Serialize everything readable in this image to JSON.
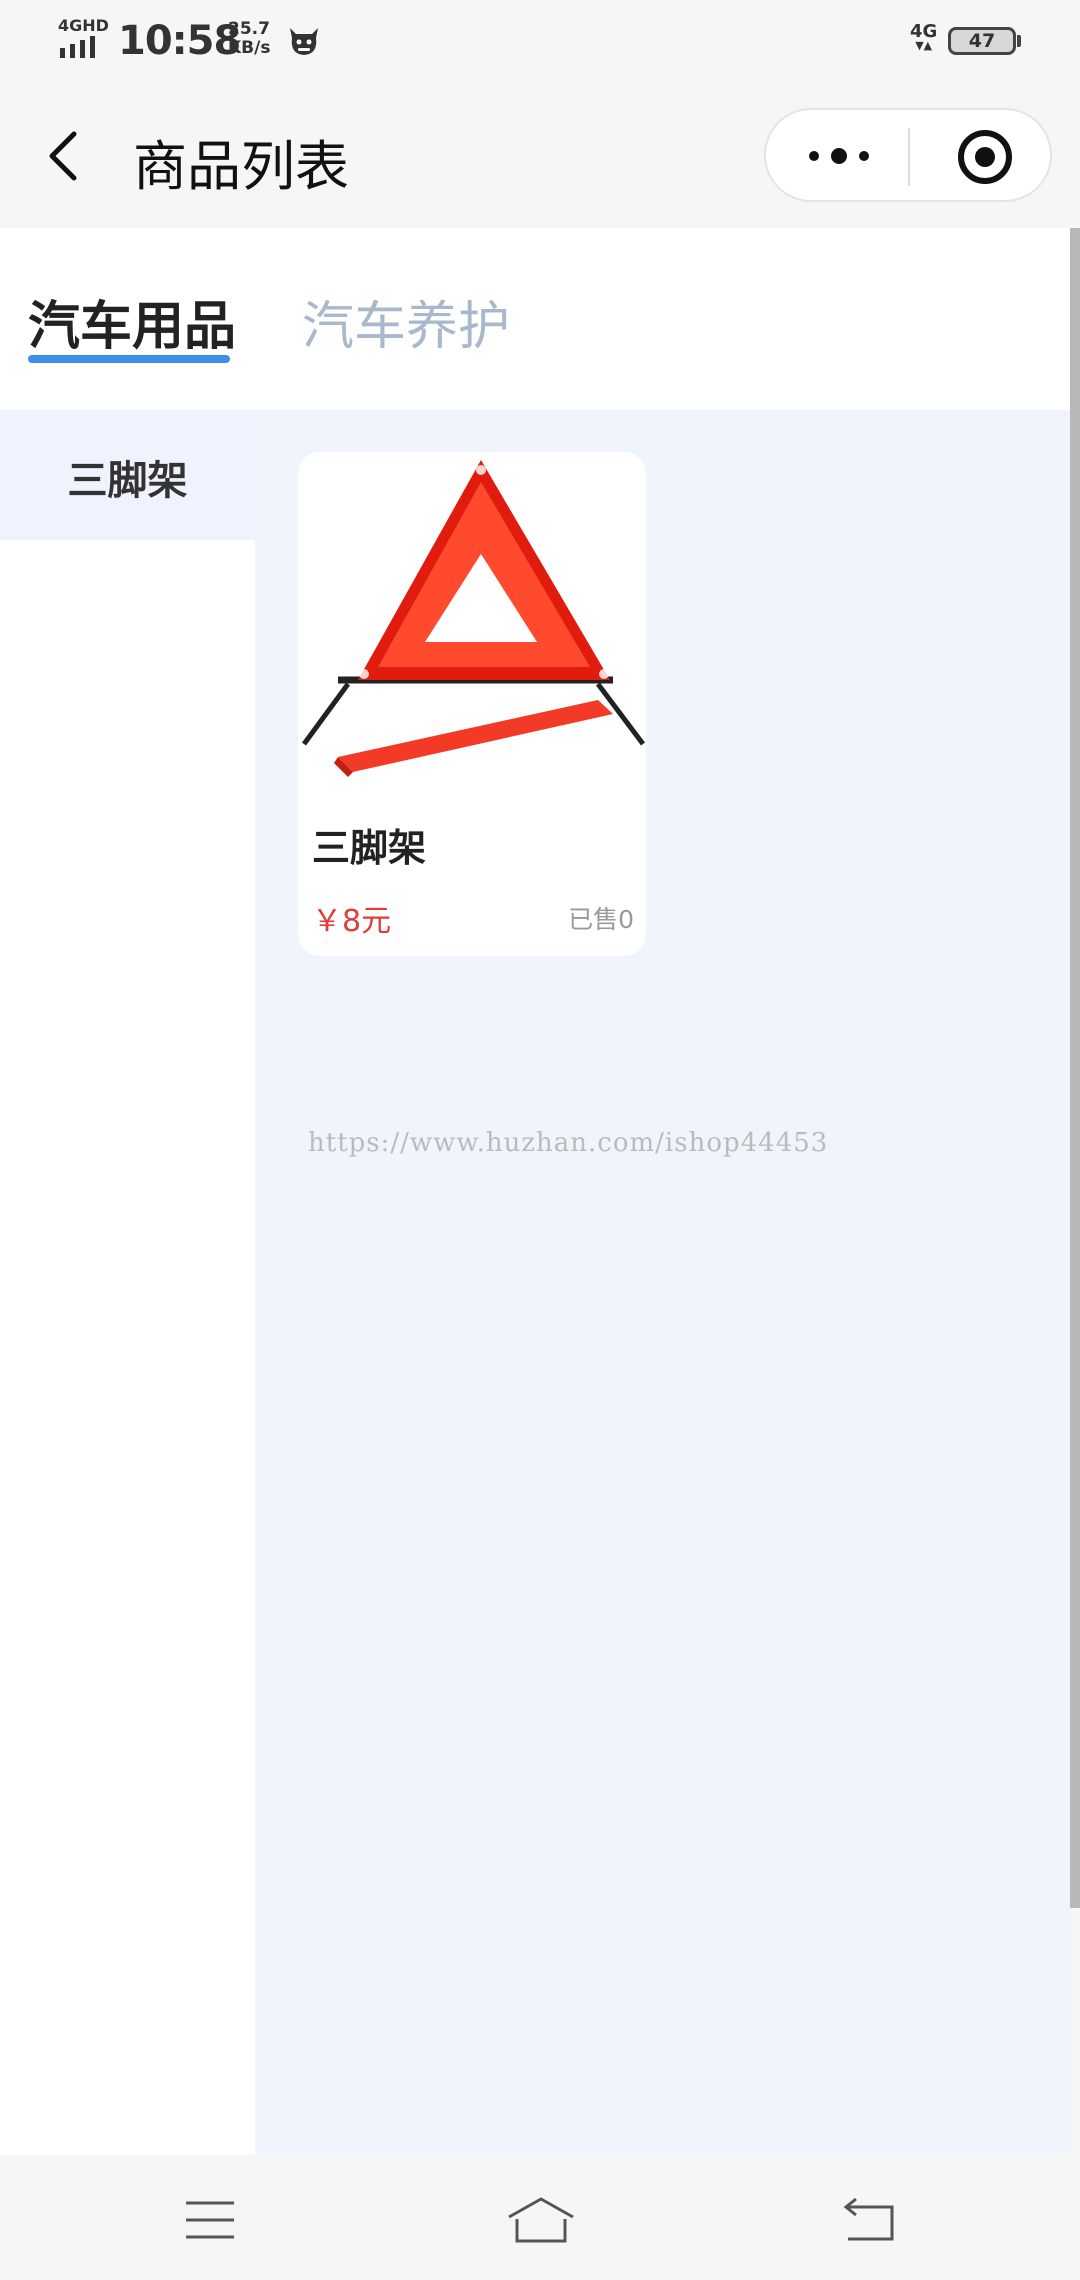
{
  "status_bar": {
    "network": "4GHD",
    "time": "10:58",
    "speed_value": "25.7",
    "speed_unit": "KB/s",
    "network_right": "4G",
    "battery": "47"
  },
  "nav": {
    "title": "商品列表",
    "icons": {
      "back": "chevron-left-icon",
      "more": "more-dots-icon",
      "close": "target-icon"
    }
  },
  "tabs": [
    {
      "label": "汽车用品",
      "active": true
    },
    {
      "label": "汽车养护",
      "active": false
    }
  ],
  "sidebar": {
    "items": [
      {
        "label": "三脚架",
        "active": true
      }
    ]
  },
  "products": [
    {
      "name": "三脚架",
      "price": "￥8元",
      "sold": "已售0",
      "image": "warning-triangle-image"
    }
  ],
  "watermark": "https://www.huzhan.com/ishop44453",
  "colors": {
    "accent": "#3c8fe8",
    "price": "#e33a3a",
    "tab_inactive": "#a9b8cc",
    "content_bg": "#eff4fd"
  }
}
